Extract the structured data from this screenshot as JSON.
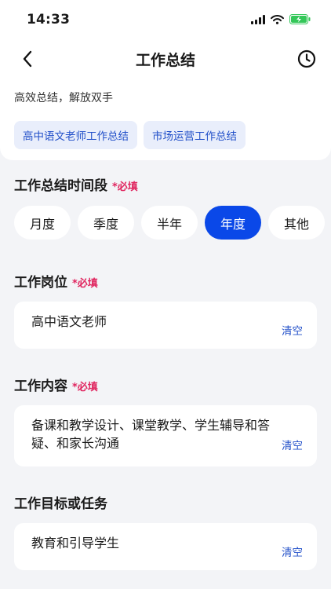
{
  "status_bar": {
    "time": "14:33"
  },
  "nav": {
    "title": "工作总结"
  },
  "intro": {
    "subtitle": "高效总结，解放双手",
    "tags": [
      "高中语文老师工作总结",
      "市场运营工作总结"
    ]
  },
  "period_section": {
    "label": "工作总结时间段",
    "required": "*必填",
    "options": [
      "月度",
      "季度",
      "半年",
      "年度",
      "其他"
    ],
    "selected": "年度"
  },
  "position_section": {
    "label": "工作岗位",
    "required": "*必填",
    "value": "高中语文老师",
    "clear_label": "清空"
  },
  "content_section": {
    "label": "工作内容",
    "required": "*必填",
    "value": "备课和教学设计、课堂教学、学生辅导和答疑、和家长沟通",
    "clear_label": "清空"
  },
  "goal_section": {
    "label": "工作目标或任务",
    "value": "教育和引导学生",
    "clear_label": "清空"
  },
  "colors": {
    "accent": "#0a48e8",
    "required": "#e0245e",
    "link": "#2250c9",
    "battery": "#34c759"
  }
}
